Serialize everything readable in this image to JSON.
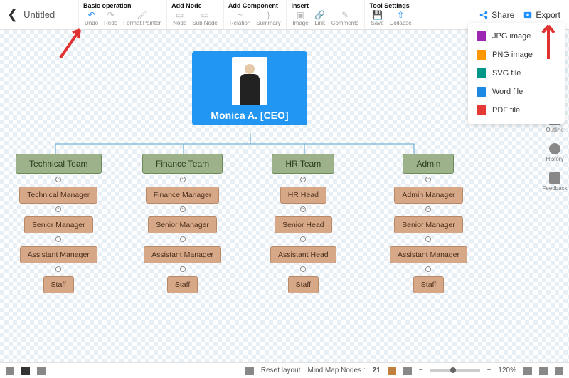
{
  "doc_title": "Untitled",
  "toolbar": {
    "groups": {
      "basic": {
        "title": "Basic operation",
        "items": [
          "Undo",
          "Redo",
          "Format Painter"
        ]
      },
      "addnode": {
        "title": "Add Node",
        "items": [
          "Node",
          "Sub Node"
        ]
      },
      "addcomp": {
        "title": "Add Component",
        "items": [
          "Relation",
          "Summary"
        ]
      },
      "insert": {
        "title": "Insert",
        "items": [
          "Image",
          "Link",
          "Comments"
        ]
      },
      "toolset": {
        "title": "Tool Settings",
        "items": [
          "Save",
          "Collapse"
        ]
      }
    },
    "share": "Share",
    "export": "Export"
  },
  "export_menu": [
    "JPG image",
    "PNG image",
    "SVG file",
    "Word file",
    "PDF file"
  ],
  "root": {
    "name": "Monica A. [CEO]"
  },
  "cols": [
    {
      "team": "Technical Team",
      "subs": [
        "Technical Manager",
        "Senior Manager",
        "Assistant Manager",
        "Staff"
      ]
    },
    {
      "team": "Finance Team",
      "subs": [
        "Finance Manager",
        "Senior Manager",
        "Assistant Manager",
        "Staff"
      ]
    },
    {
      "team": "HR Team",
      "subs": [
        "HR Head",
        "Senior Head",
        "Assistant Head",
        "Staff"
      ]
    },
    {
      "team": "Admin",
      "subs": [
        "Admin Manager",
        "Senior Manager",
        "Assistant Manager",
        "Staff"
      ]
    }
  ],
  "side": [
    "Outline",
    "History",
    "Feedback"
  ],
  "bottom": {
    "reset": "Reset layout",
    "nodes_label": "Mind Map Nodes :",
    "nodes": "21",
    "zoom": "120%"
  }
}
